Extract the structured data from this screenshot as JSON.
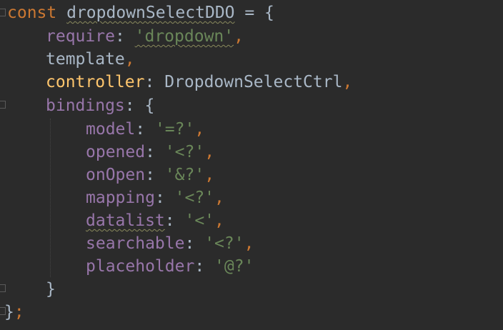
{
  "code": {
    "line0": {
      "keyword": "const",
      "name": "dropdownSelectDDO",
      "rest": " = {"
    },
    "line1": {
      "key": "require",
      "sep": ": ",
      "value": "'dropdown'",
      "comma": ","
    },
    "line2": {
      "key": "template",
      "comma": ","
    },
    "line3": {
      "key": "controller",
      "sep": ": ",
      "value": "DropdownSelectCtrl",
      "comma": ","
    },
    "line4": {
      "key": "bindings",
      "sep": ": {"
    },
    "bindings": [
      {
        "key": "model",
        "sep": ": ",
        "value": "'=?'",
        "comma": ","
      },
      {
        "key": "opened",
        "sep": ": ",
        "value": "'<?'",
        "comma": ","
      },
      {
        "key": "onOpen",
        "sep": ": ",
        "value": "'&?'",
        "comma": ","
      },
      {
        "key": "mapping",
        "sep": ": ",
        "value": "'<?'",
        "comma": ","
      },
      {
        "key": "datalist",
        "sep": ": ",
        "value": "'<'",
        "comma": ","
      },
      {
        "key": "searchable",
        "sep": ": ",
        "value": "'<?'",
        "comma": ","
      },
      {
        "key": "placeholder",
        "sep": ": ",
        "value": "'@?'",
        "comma": ""
      }
    ],
    "close_inner": "}",
    "close_outer": "}",
    "close_semicolon": ";"
  },
  "colors": {
    "background": "#2b2b2b",
    "keyword": "#cc7832",
    "property": "#9876aa",
    "string": "#6a8759",
    "text": "#a9b7c6",
    "method": "#ffc66d"
  },
  "gutter_icons": [
    "fold-open-icon",
    "fold-open-icon",
    "fold-close-icon",
    "fold-close-icon"
  ]
}
